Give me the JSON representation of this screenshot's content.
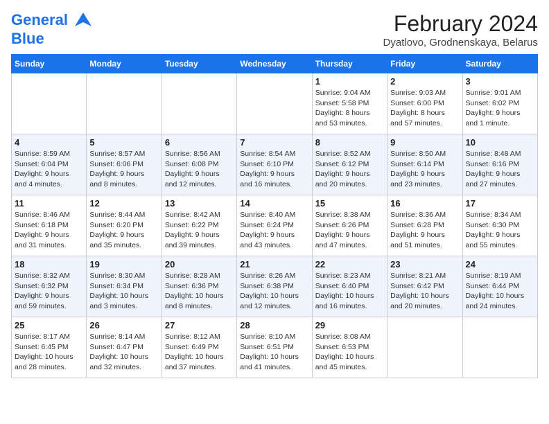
{
  "header": {
    "logo_line1": "General",
    "logo_line2": "Blue",
    "title": "February 2024",
    "subtitle": "Dyatlovo, Grodnenskaya, Belarus"
  },
  "columns": [
    "Sunday",
    "Monday",
    "Tuesday",
    "Wednesday",
    "Thursday",
    "Friday",
    "Saturday"
  ],
  "rows": [
    [
      {
        "day": "",
        "info": ""
      },
      {
        "day": "",
        "info": ""
      },
      {
        "day": "",
        "info": ""
      },
      {
        "day": "",
        "info": ""
      },
      {
        "day": "1",
        "info": "Sunrise: 9:04 AM\nSunset: 5:58 PM\nDaylight: 8 hours\nand 53 minutes."
      },
      {
        "day": "2",
        "info": "Sunrise: 9:03 AM\nSunset: 6:00 PM\nDaylight: 8 hours\nand 57 minutes."
      },
      {
        "day": "3",
        "info": "Sunrise: 9:01 AM\nSunset: 6:02 PM\nDaylight: 9 hours\nand 1 minute."
      }
    ],
    [
      {
        "day": "4",
        "info": "Sunrise: 8:59 AM\nSunset: 6:04 PM\nDaylight: 9 hours\nand 4 minutes."
      },
      {
        "day": "5",
        "info": "Sunrise: 8:57 AM\nSunset: 6:06 PM\nDaylight: 9 hours\nand 8 minutes."
      },
      {
        "day": "6",
        "info": "Sunrise: 8:56 AM\nSunset: 6:08 PM\nDaylight: 9 hours\nand 12 minutes."
      },
      {
        "day": "7",
        "info": "Sunrise: 8:54 AM\nSunset: 6:10 PM\nDaylight: 9 hours\nand 16 minutes."
      },
      {
        "day": "8",
        "info": "Sunrise: 8:52 AM\nSunset: 6:12 PM\nDaylight: 9 hours\nand 20 minutes."
      },
      {
        "day": "9",
        "info": "Sunrise: 8:50 AM\nSunset: 6:14 PM\nDaylight: 9 hours\nand 23 minutes."
      },
      {
        "day": "10",
        "info": "Sunrise: 8:48 AM\nSunset: 6:16 PM\nDaylight: 9 hours\nand 27 minutes."
      }
    ],
    [
      {
        "day": "11",
        "info": "Sunrise: 8:46 AM\nSunset: 6:18 PM\nDaylight: 9 hours\nand 31 minutes."
      },
      {
        "day": "12",
        "info": "Sunrise: 8:44 AM\nSunset: 6:20 PM\nDaylight: 9 hours\nand 35 minutes."
      },
      {
        "day": "13",
        "info": "Sunrise: 8:42 AM\nSunset: 6:22 PM\nDaylight: 9 hours\nand 39 minutes."
      },
      {
        "day": "14",
        "info": "Sunrise: 8:40 AM\nSunset: 6:24 PM\nDaylight: 9 hours\nand 43 minutes."
      },
      {
        "day": "15",
        "info": "Sunrise: 8:38 AM\nSunset: 6:26 PM\nDaylight: 9 hours\nand 47 minutes."
      },
      {
        "day": "16",
        "info": "Sunrise: 8:36 AM\nSunset: 6:28 PM\nDaylight: 9 hours\nand 51 minutes."
      },
      {
        "day": "17",
        "info": "Sunrise: 8:34 AM\nSunset: 6:30 PM\nDaylight: 9 hours\nand 55 minutes."
      }
    ],
    [
      {
        "day": "18",
        "info": "Sunrise: 8:32 AM\nSunset: 6:32 PM\nDaylight: 9 hours\nand 59 minutes."
      },
      {
        "day": "19",
        "info": "Sunrise: 8:30 AM\nSunset: 6:34 PM\nDaylight: 10 hours\nand 3 minutes."
      },
      {
        "day": "20",
        "info": "Sunrise: 8:28 AM\nSunset: 6:36 PM\nDaylight: 10 hours\nand 8 minutes."
      },
      {
        "day": "21",
        "info": "Sunrise: 8:26 AM\nSunset: 6:38 PM\nDaylight: 10 hours\nand 12 minutes."
      },
      {
        "day": "22",
        "info": "Sunrise: 8:23 AM\nSunset: 6:40 PM\nDaylight: 10 hours\nand 16 minutes."
      },
      {
        "day": "23",
        "info": "Sunrise: 8:21 AM\nSunset: 6:42 PM\nDaylight: 10 hours\nand 20 minutes."
      },
      {
        "day": "24",
        "info": "Sunrise: 8:19 AM\nSunset: 6:44 PM\nDaylight: 10 hours\nand 24 minutes."
      }
    ],
    [
      {
        "day": "25",
        "info": "Sunrise: 8:17 AM\nSunset: 6:45 PM\nDaylight: 10 hours\nand 28 minutes."
      },
      {
        "day": "26",
        "info": "Sunrise: 8:14 AM\nSunset: 6:47 PM\nDaylight: 10 hours\nand 32 minutes."
      },
      {
        "day": "27",
        "info": "Sunrise: 8:12 AM\nSunset: 6:49 PM\nDaylight: 10 hours\nand 37 minutes."
      },
      {
        "day": "28",
        "info": "Sunrise: 8:10 AM\nSunset: 6:51 PM\nDaylight: 10 hours\nand 41 minutes."
      },
      {
        "day": "29",
        "info": "Sunrise: 8:08 AM\nSunset: 6:53 PM\nDaylight: 10 hours\nand 45 minutes."
      },
      {
        "day": "",
        "info": ""
      },
      {
        "day": "",
        "info": ""
      }
    ]
  ]
}
